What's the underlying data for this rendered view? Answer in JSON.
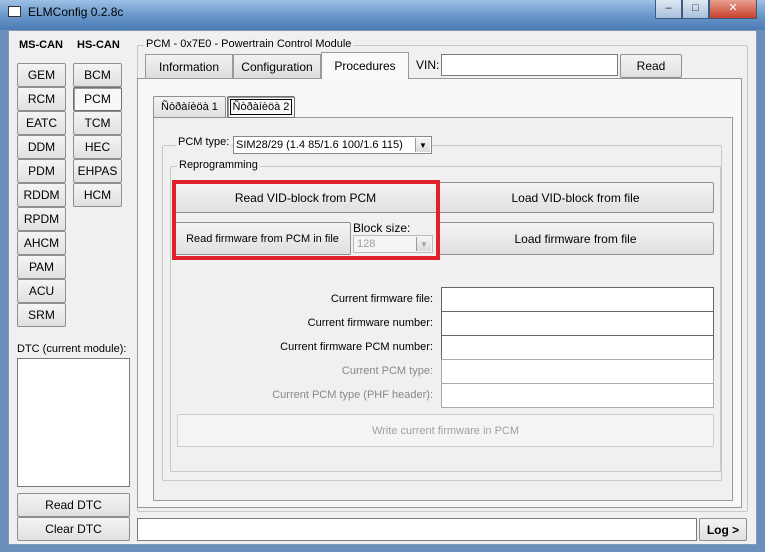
{
  "window": {
    "title": "ELMConfig 0.2.8c",
    "controls": [
      "–",
      "□",
      "✕"
    ]
  },
  "bus": {
    "ms_label": "MS-CAN",
    "hs_label": "HS-CAN",
    "ms": [
      "GEM",
      "RCM",
      "EATC",
      "DDM",
      "PDM",
      "RDDM",
      "RPDM",
      "AHCM",
      "PAM",
      "ACU",
      "SRM"
    ],
    "hs": [
      "BCM",
      "PCM",
      "TCM",
      "HEC",
      "EHPAS",
      "HCM"
    ],
    "selected": "PCM"
  },
  "dtc": {
    "label": "DTC (current module):",
    "read": "Read DTC",
    "clear": "Clear DTC"
  },
  "module": {
    "title": "PCM - 0x7E0 - Powertrain Control Module",
    "tabs": [
      "Information",
      "Configuration",
      "Procedures"
    ],
    "active_tab": "Procedures",
    "vin_label": "VIN:",
    "vin_value": "",
    "read": "Read",
    "subtabs": [
      "Ñòðàíèöà 1",
      "Ñòðàíèöà 2"
    ],
    "active_subtab": "Ñòðàíèöà 2",
    "pcm_type_label": "PCM type:",
    "pcm_type_value": "SIM28/29 (1.4 85/1.6 100/1.6 115)",
    "reprogramming": "Reprogramming",
    "read_vid": "Read VID-block from PCM",
    "load_vid": "Load VID-block from file",
    "read_fw": "Read firmware from PCM in file",
    "block_size_label": "Block size:",
    "block_size_value": "128",
    "load_fw": "Load firmware from file",
    "fields": [
      {
        "label": "Current firmware file:",
        "value": "",
        "enabled": true
      },
      {
        "label": "Current firmware number:",
        "value": "",
        "enabled": true
      },
      {
        "label": "Current firmware PCM number:",
        "value": "",
        "enabled": true
      },
      {
        "label": "Current PCM type:",
        "value": "",
        "enabled": false
      },
      {
        "label": "Current PCM type (PHF header):",
        "value": "",
        "enabled": false
      }
    ],
    "write": "Write current firmware in PCM"
  },
  "status": {
    "value": "",
    "log": "Log >"
  },
  "colors": {
    "highlight": "#e0202a",
    "titlebar": "#6f9ccd"
  }
}
